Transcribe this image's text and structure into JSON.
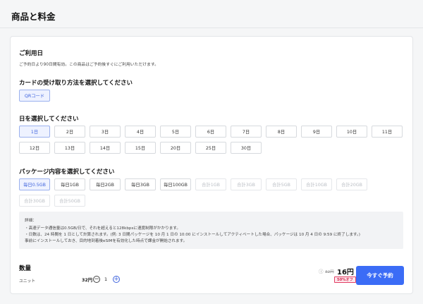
{
  "page": {
    "title": "商品と料金"
  },
  "usage": {
    "heading": "ご利用日",
    "note": "ご予約日より90日間有効。この商品はご予約後すぐにご利用いただけます。"
  },
  "receive": {
    "heading": "カードの受け取り方法を選択してください",
    "options": [
      {
        "label": "QRコード",
        "state": "selected"
      }
    ]
  },
  "days": {
    "heading": "日を選択してください",
    "options": [
      {
        "label": "1日",
        "state": "selected"
      },
      {
        "label": "2日",
        "state": "normal"
      },
      {
        "label": "3日",
        "state": "normal"
      },
      {
        "label": "4日",
        "state": "normal"
      },
      {
        "label": "5日",
        "state": "normal"
      },
      {
        "label": "6日",
        "state": "normal"
      },
      {
        "label": "7日",
        "state": "normal"
      },
      {
        "label": "8日",
        "state": "normal"
      },
      {
        "label": "9日",
        "state": "normal"
      },
      {
        "label": "10日",
        "state": "normal"
      },
      {
        "label": "11日",
        "state": "normal"
      },
      {
        "label": "12日",
        "state": "normal"
      },
      {
        "label": "13日",
        "state": "normal"
      },
      {
        "label": "14日",
        "state": "normal"
      },
      {
        "label": "15日",
        "state": "normal"
      },
      {
        "label": "20日",
        "state": "normal"
      },
      {
        "label": "25日",
        "state": "normal"
      },
      {
        "label": "30日",
        "state": "normal"
      }
    ]
  },
  "package": {
    "heading": "パッケージ内容を選択してください",
    "options": [
      {
        "label": "毎日0.5GB",
        "state": "selected"
      },
      {
        "label": "毎日1GB",
        "state": "normal"
      },
      {
        "label": "毎日2GB",
        "state": "normal"
      },
      {
        "label": "毎日3GB",
        "state": "normal"
      },
      {
        "label": "毎日100GB",
        "state": "normal"
      },
      {
        "label": "合計1GB",
        "state": "disabled"
      },
      {
        "label": "合計3GB",
        "state": "disabled"
      },
      {
        "label": "合計5GB",
        "state": "disabled"
      },
      {
        "label": "合計10GB",
        "state": "disabled"
      },
      {
        "label": "合計20GB",
        "state": "disabled"
      },
      {
        "label": "合計30GB",
        "state": "disabled"
      },
      {
        "label": "合計50GB",
        "state": "disabled"
      }
    ]
  },
  "details": {
    "title": "詳細：",
    "lines": [
      "・高速データ通信量は0.5GB/日で、それを超えると128kbpsに速度制限がかかります。",
      "・日数は、24 時間を 1 日として計算されます。(例: 3 日間パッケージを 10 月 1 日の 10:00 にインストールしてアクティベートした場合、パッケージは 10 月 4 日の 9:59 に終了します。)",
      "事前にインストールしておき、目的地到着後eSIMを有効化した時点で課金が開始されます。"
    ]
  },
  "quantity": {
    "heading": "数量",
    "unit_label": "ユニット",
    "unit_price": "32円",
    "value": "1",
    "minus_symbol": "−",
    "plus_symbol": "+"
  },
  "pricing": {
    "info_symbol": "ⓘ",
    "original_price": "32円",
    "sale_price": "16円",
    "discount_badge": "50%オフ",
    "buy_button": "今すぐ予約"
  },
  "colors": {
    "accent": "#3b6cf6",
    "selected_border": "#9bb1ee",
    "discount_red": "#d6284f"
  }
}
